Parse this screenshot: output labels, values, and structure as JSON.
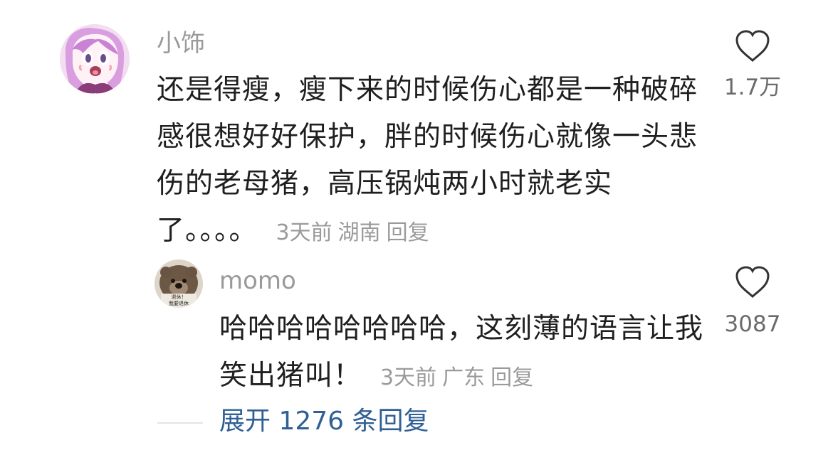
{
  "comment": {
    "username": "小饰",
    "avatar": "anime-pink-hair-avatar",
    "text": "还是得瘦，瘦下来的时候伤心都是一种破碎感很想好好保护，胖的时候伤心就像一头悲伤的老母猪，高压锅炖两小时就老实了。。。。",
    "time": "3天前",
    "location": "湖南",
    "reply_label": "回复",
    "likes": "1.7万",
    "like_icon": "heart-outline-icon"
  },
  "reply": {
    "username": "momo",
    "avatar": "bear-meme-avatar",
    "avatar_text_1": "退休！",
    "avatar_text_2": "我要退休",
    "text": "哈哈哈哈哈哈哈哈，这刻薄的语言让我笑出猪叫！",
    "time": "3天前",
    "location": "广东",
    "reply_label": "回复",
    "likes": "3087",
    "like_icon": "heart-outline-icon"
  },
  "expand": {
    "label": "展开 1276 条回复"
  },
  "colors": {
    "primary_text": "#1f1f1f",
    "secondary_text": "#9a9a9a",
    "link": "#2f5f95",
    "background": "#ffffff"
  }
}
